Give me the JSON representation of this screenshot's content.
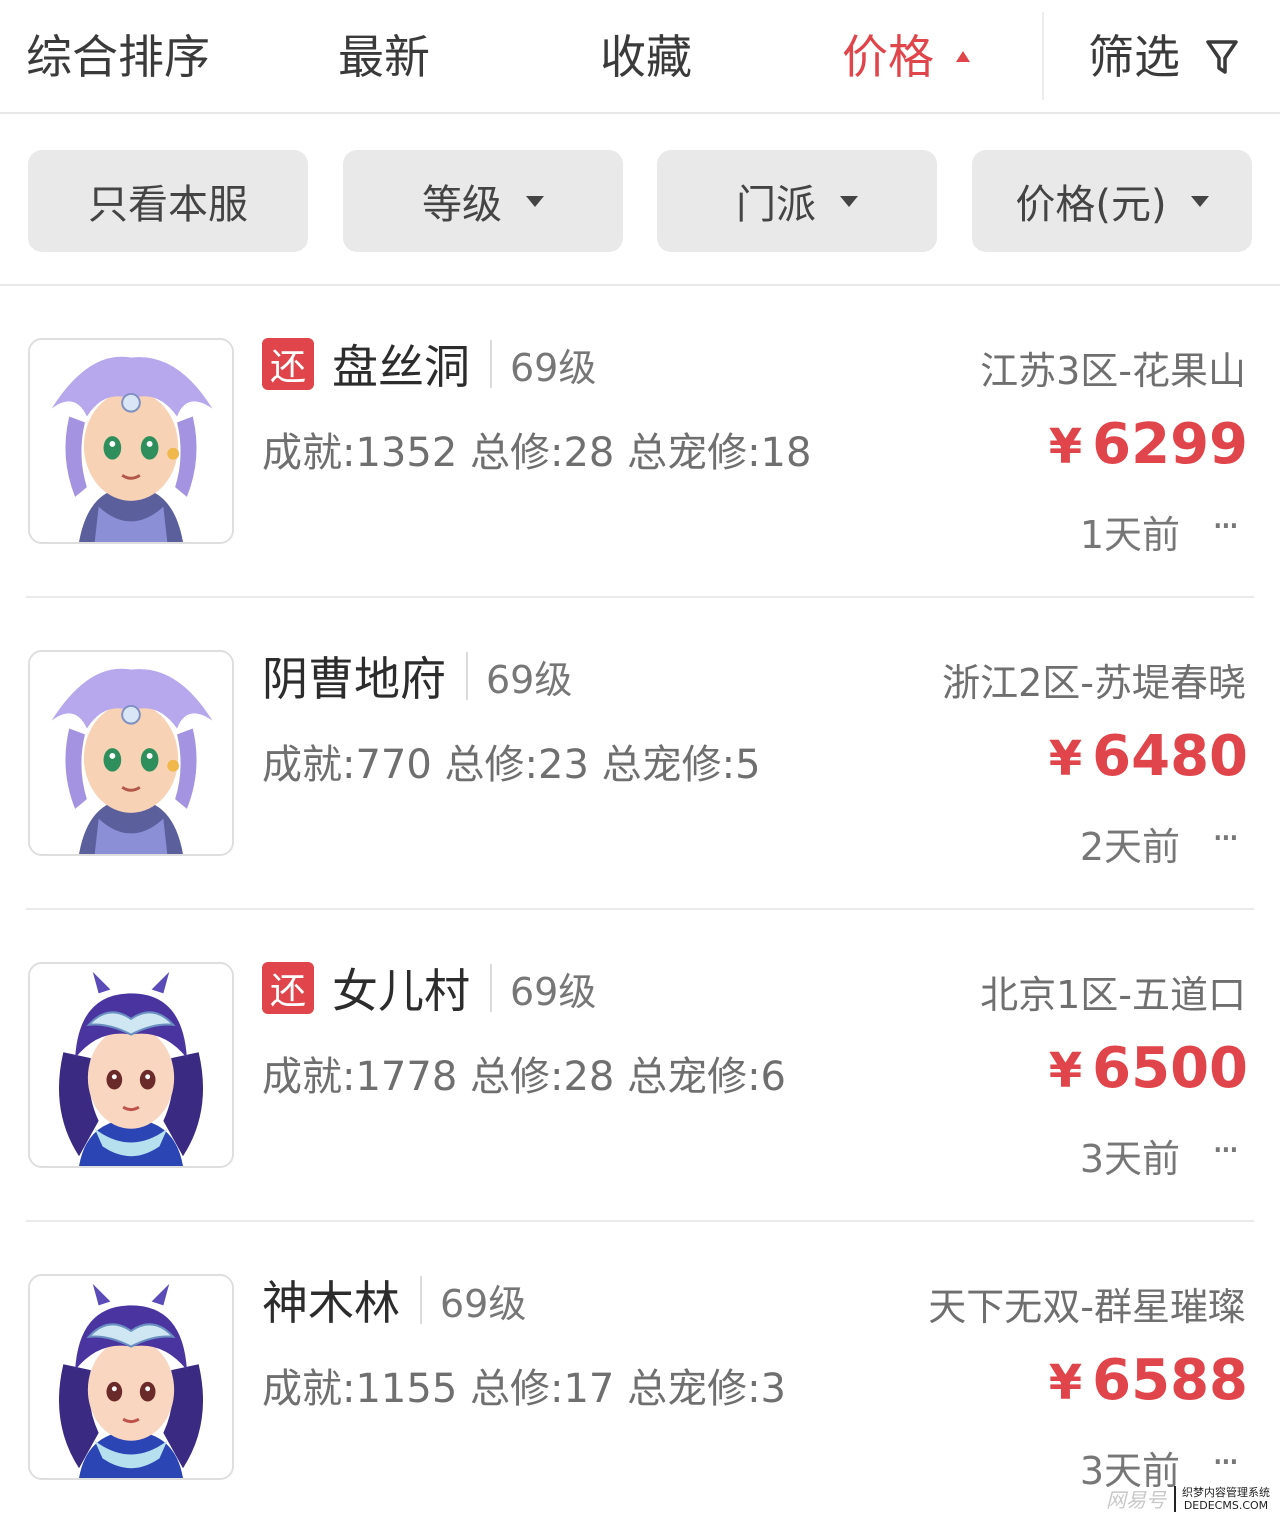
{
  "sort_bar": {
    "items": [
      {
        "label": "综合排序"
      },
      {
        "label": "最新"
      },
      {
        "label": "收藏"
      },
      {
        "label": "价格"
      }
    ],
    "active_index": 3,
    "filter_label": "筛选",
    "icons": {
      "sort_direction": "caret-up-icon",
      "filter": "funnel-icon"
    },
    "active_color": "#e0454b"
  },
  "filters": [
    {
      "label": "只看本服",
      "has_dropdown": false
    },
    {
      "label": "等级",
      "has_dropdown": true
    },
    {
      "label": "门派",
      "has_dropdown": true
    },
    {
      "label": "价格(元)",
      "has_dropdown": true
    }
  ],
  "listings": [
    {
      "tag": "还",
      "school": "盘丝洞",
      "level": "69级",
      "stats": "成就:1352 总修:28 总宠修:18",
      "server": "江苏3区-花果山",
      "currency": "¥",
      "price": "6299",
      "time": "1天前",
      "more": "···",
      "avatar": "lavender-hair-character"
    },
    {
      "tag": "",
      "school": "阴曹地府",
      "level": "69级",
      "stats": "成就:770 总修:23 总宠修:5",
      "server": "浙江2区-苏堤春晓",
      "currency": "¥",
      "price": "6480",
      "time": "2天前",
      "more": "···",
      "avatar": "lavender-hair-character"
    },
    {
      "tag": "还",
      "school": "女儿村",
      "level": "69级",
      "stats": "成就:1778 总修:28 总宠修:6",
      "server": "北京1区-五道口",
      "currency": "¥",
      "price": "6500",
      "time": "3天前",
      "more": "···",
      "avatar": "purple-hair-character"
    },
    {
      "tag": "",
      "school": "神木林",
      "level": "69级",
      "stats": "成就:1155 总修:17 总宠修:3",
      "server": "天下无双-群星璀璨",
      "currency": "¥",
      "price": "6588",
      "time": "3天前",
      "more": "···",
      "avatar": "purple-hair-character"
    }
  ],
  "watermark": {
    "text": "网易号",
    "logo_line1": "织梦内容管理系统",
    "logo_line2": "DEDECMS.COM"
  }
}
